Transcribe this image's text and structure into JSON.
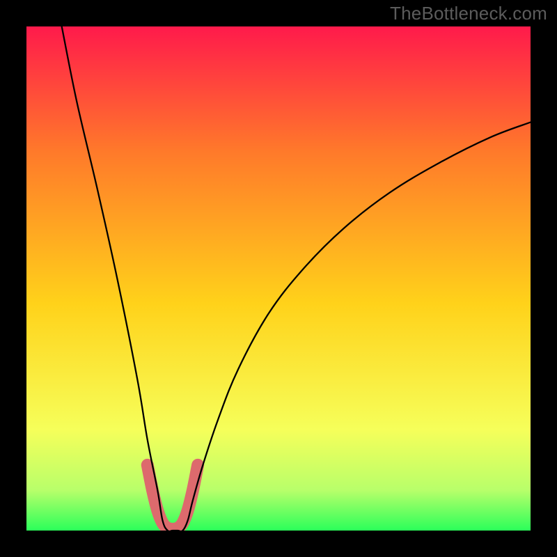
{
  "watermark": "TheBottleneck.com",
  "chart_data": {
    "type": "line",
    "title": "",
    "xlabel": "",
    "ylabel": "",
    "xlim": [
      0,
      100
    ],
    "ylim": [
      0,
      100
    ],
    "series": [
      {
        "name": "bottleneck-curve",
        "x": [
          7,
          10,
          14,
          18,
          22,
          24,
          26,
          27,
          28,
          29,
          30,
          31,
          32,
          33,
          35,
          38,
          42,
          48,
          55,
          63,
          72,
          82,
          92,
          100
        ],
        "values": [
          100,
          85,
          68,
          50,
          30,
          18,
          8,
          2,
          0,
          0,
          0,
          0,
          2,
          6,
          13,
          22,
          32,
          43,
          52,
          60,
          67,
          73,
          78,
          81
        ]
      },
      {
        "name": "highlight-segment",
        "x": [
          24,
          25,
          26,
          27,
          28,
          29,
          30,
          31,
          32,
          33,
          34
        ],
        "values": [
          13,
          8,
          4,
          1.5,
          0.5,
          0.3,
          0.5,
          1.5,
          4,
          8,
          13
        ]
      }
    ],
    "background_gradient": {
      "top": "#ff1a4b",
      "upper_mid": "#ff7a2a",
      "mid": "#ffd21a",
      "lower_mid": "#f6ff5a",
      "band": "#b8ff6a",
      "bottom": "#2bff5a"
    },
    "border_color": "#000000",
    "border_width": 38,
    "curve_color": "#000000",
    "curve_width": 2.3,
    "highlight_color": "#dd6a6d",
    "highlight_width": 18
  }
}
